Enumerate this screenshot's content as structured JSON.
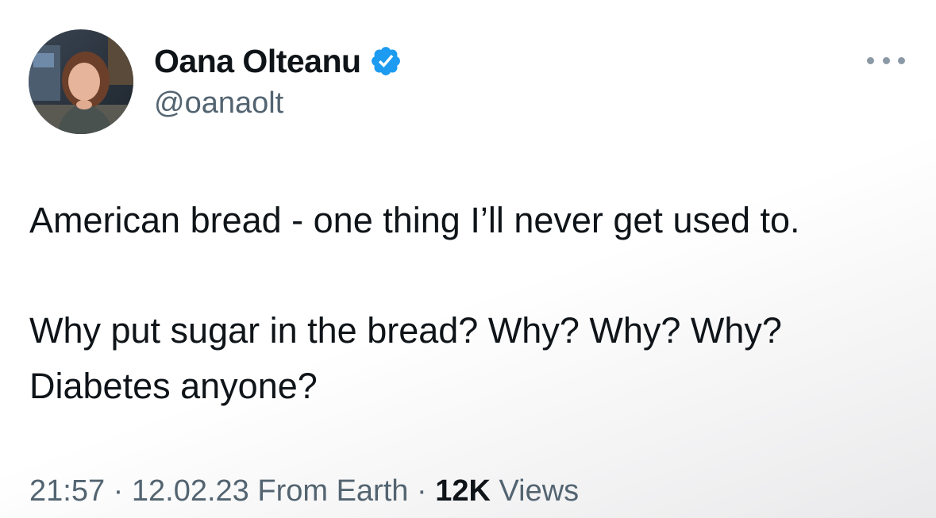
{
  "author": {
    "display_name": "Oana Olteanu",
    "handle": "@oanaolt",
    "verified": true
  },
  "tweet": {
    "lines": [
      "American bread - one thing I’ll never get used to.",
      "Why put sugar in the bread? Why? Why? Why?",
      "Diabetes anyone?"
    ],
    "time": "21:57",
    "date": "12.02.23",
    "source": "From Earth",
    "views_count": "12K",
    "views_label": "Views",
    "separator": "·"
  },
  "icons": {
    "verified": "verified-badge-icon",
    "more": "more-options-icon"
  },
  "colors": {
    "primary_text": "#0f1419",
    "secondary_text": "#536471",
    "verified_blue": "#1d9bf0"
  }
}
